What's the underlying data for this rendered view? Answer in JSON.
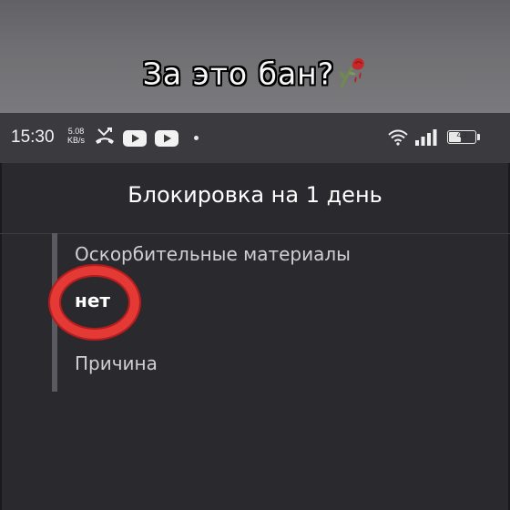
{
  "caption": {
    "text": "За это бан?",
    "emoji_icon": "wilted-rose-icon"
  },
  "status_bar": {
    "time": "15:30",
    "net_speed_value": "5.08",
    "net_speed_unit": "KB/s",
    "icons": [
      "missed-call-icon",
      "youtube-icon",
      "youtube-icon",
      "notification-dot-icon",
      "wifi-icon",
      "signal-icon",
      "battery-icon"
    ],
    "battery_level": "43"
  },
  "dialog": {
    "title": "Блокировка на 1 день",
    "category": "Оскорбительные материалы",
    "value": "нет",
    "reason_label": "Причина"
  },
  "colors": {
    "highlight_ring": "#e53935",
    "dialog_bg": "#29292e",
    "status_bar_bg": "#3b3b3f"
  }
}
